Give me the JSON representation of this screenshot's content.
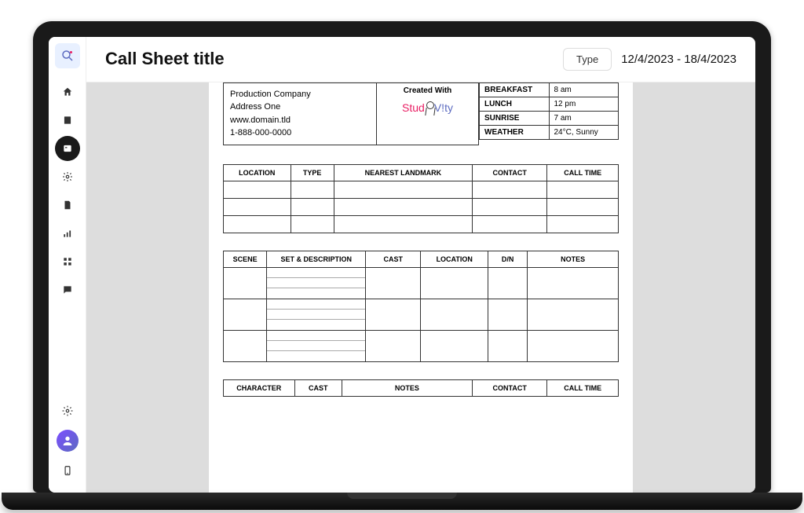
{
  "header": {
    "title": "Call Sheet title",
    "type_button": "Type",
    "date_range": "12/4/2023 - 18/4/2023"
  },
  "production": {
    "company": "Production Company",
    "address": "Address One",
    "website": "www.domain.tld",
    "phone": "1-888-000-0000"
  },
  "created_with": {
    "label": "Created With",
    "brand_part1": "Stud",
    "brand_part2": "V!ty"
  },
  "schedule": {
    "rows": [
      {
        "label": "BREAKFAST",
        "value": "8 am"
      },
      {
        "label": "LUNCH",
        "value": "12 pm"
      },
      {
        "label": "SUNRISE",
        "value": "7 am"
      },
      {
        "label": "WEATHER",
        "value": "24°C, Sunny"
      }
    ]
  },
  "table_location": {
    "headers": [
      "LOCATION",
      "TYPE",
      "NEAREST LANDMARK",
      "CONTACT",
      "CALL TIME"
    ]
  },
  "table_scene": {
    "headers": [
      "SCENE",
      "SET & DESCRIPTION",
      "CAST",
      "LOCATION",
      "D/N",
      "NOTES"
    ]
  },
  "table_character": {
    "headers": [
      "CHARACTER",
      "CAST",
      "NOTES",
      "CONTACT",
      "CALL TIME"
    ]
  },
  "sidebar": {
    "items": [
      "home",
      "script",
      "callsheet",
      "settings-cog",
      "document",
      "chart",
      "grid",
      "chat"
    ],
    "bottom": [
      "settings",
      "avatar",
      "mobile"
    ]
  }
}
